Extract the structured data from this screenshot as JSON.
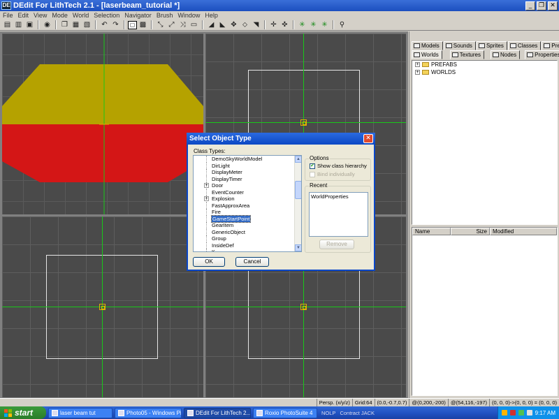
{
  "window": {
    "title": "DEdit For LithTech 2.1 - [laserbeam_tutorial *]",
    "buttons": [
      "minimize",
      "restore",
      "close"
    ]
  },
  "menu": [
    "File",
    "Edit",
    "View",
    "Mode",
    "World",
    "Selection",
    "Navigator",
    "Brush",
    "Window",
    "Help"
  ],
  "toolbar": {
    "icons": [
      "new-icon",
      "open-icon",
      "save-icon",
      "print-icon",
      "copy-icon",
      "cut-icon",
      "paste-icon",
      "undo-icon",
      "redo-icon",
      "grid-icon",
      "geometry-mode-icon",
      "brush-mode-icon",
      "object-mode-icon",
      "patch-mode-icon",
      "vertex-icon",
      "face-icon",
      "move-icon",
      "select-icon",
      "snap-icon",
      "axis-icon",
      "tool-icon"
    ]
  },
  "viewports": {
    "perspective": {
      "colors": {
        "top_face": "#b5a200",
        "front_face": "#d41616",
        "grid": "#4a4a4a"
      }
    },
    "axis_color": "#19c819"
  },
  "right_panel": {
    "tabs_row1": [
      "Models",
      "Sounds",
      "Sprites",
      "Classes",
      "Prefabs"
    ],
    "tabs_row2": [
      "Worlds",
      "Textures",
      "Nodes",
      "Properties"
    ],
    "active_tab": "Worlds",
    "tree": [
      {
        "label": "PREFABS"
      },
      {
        "label": "WORLDS"
      }
    ],
    "list_headers": [
      "Name",
      "Size",
      "Modified"
    ]
  },
  "dialog": {
    "title": "Select Object Type",
    "class_types_label": "Class Types:",
    "class_types": [
      {
        "label": "DemoSkyWorldModel",
        "expandable": false,
        "selected": false
      },
      {
        "label": "DirLight",
        "expandable": false,
        "selected": false
      },
      {
        "label": "DisplayMeter",
        "expandable": false,
        "selected": false
      },
      {
        "label": "DisplayTimer",
        "expandable": false,
        "selected": false
      },
      {
        "label": "Door",
        "expandable": true,
        "selected": false
      },
      {
        "label": "EventCounter",
        "expandable": false,
        "selected": false
      },
      {
        "label": "Explosion",
        "expandable": true,
        "selected": false
      },
      {
        "label": "FastApproxArea",
        "expandable": false,
        "selected": false
      },
      {
        "label": "Fire",
        "expandable": false,
        "selected": false
      },
      {
        "label": "GameStartPoint",
        "expandable": false,
        "selected": true
      },
      {
        "label": "GearItem",
        "expandable": false,
        "selected": false
      },
      {
        "label": "GenericObject",
        "expandable": false,
        "selected": false
      },
      {
        "label": "Group",
        "expandable": false,
        "selected": false
      },
      {
        "label": "InsideDef",
        "expandable": false,
        "selected": false
      },
      {
        "label": "K...",
        "expandable": false,
        "selected": false
      }
    ],
    "options": {
      "title": "Options",
      "show_class_hierarchy": {
        "label": "Show class hierarchy",
        "checked": true,
        "enabled": true
      },
      "bind_individually": {
        "label": "Bind individually",
        "checked": false,
        "enabled": false
      }
    },
    "recent": {
      "title": "Recent",
      "items": [
        "WorldProperties"
      ],
      "remove_label": "Remove"
    },
    "ok_label": "OK",
    "cancel_label": "Cancel"
  },
  "status_bar": {
    "mode": "Persp. (x/y/z)",
    "grid": "Grid:64",
    "coords1": "(0.0,-0.7,0.7)",
    "coords2": "@(0,200,-200)",
    "coords3": "@(54,116,-197)",
    "coords4": "(0, 0, 0)->(0, 0, 0) = (0, 0, 0)"
  },
  "taskbar": {
    "start_label": "start",
    "buttons": [
      {
        "label": "laser beam tut",
        "active": false
      },
      {
        "label": "Photo05 - Windows Pi...",
        "active": false
      },
      {
        "label": "DEdit For LithTech 2....",
        "active": true
      },
      {
        "label": "Roxio PhotoSuite 4",
        "active": false
      }
    ],
    "tray_labels": [
      "NOLP",
      "Contract JACK"
    ],
    "clock": "9:17 AM"
  }
}
